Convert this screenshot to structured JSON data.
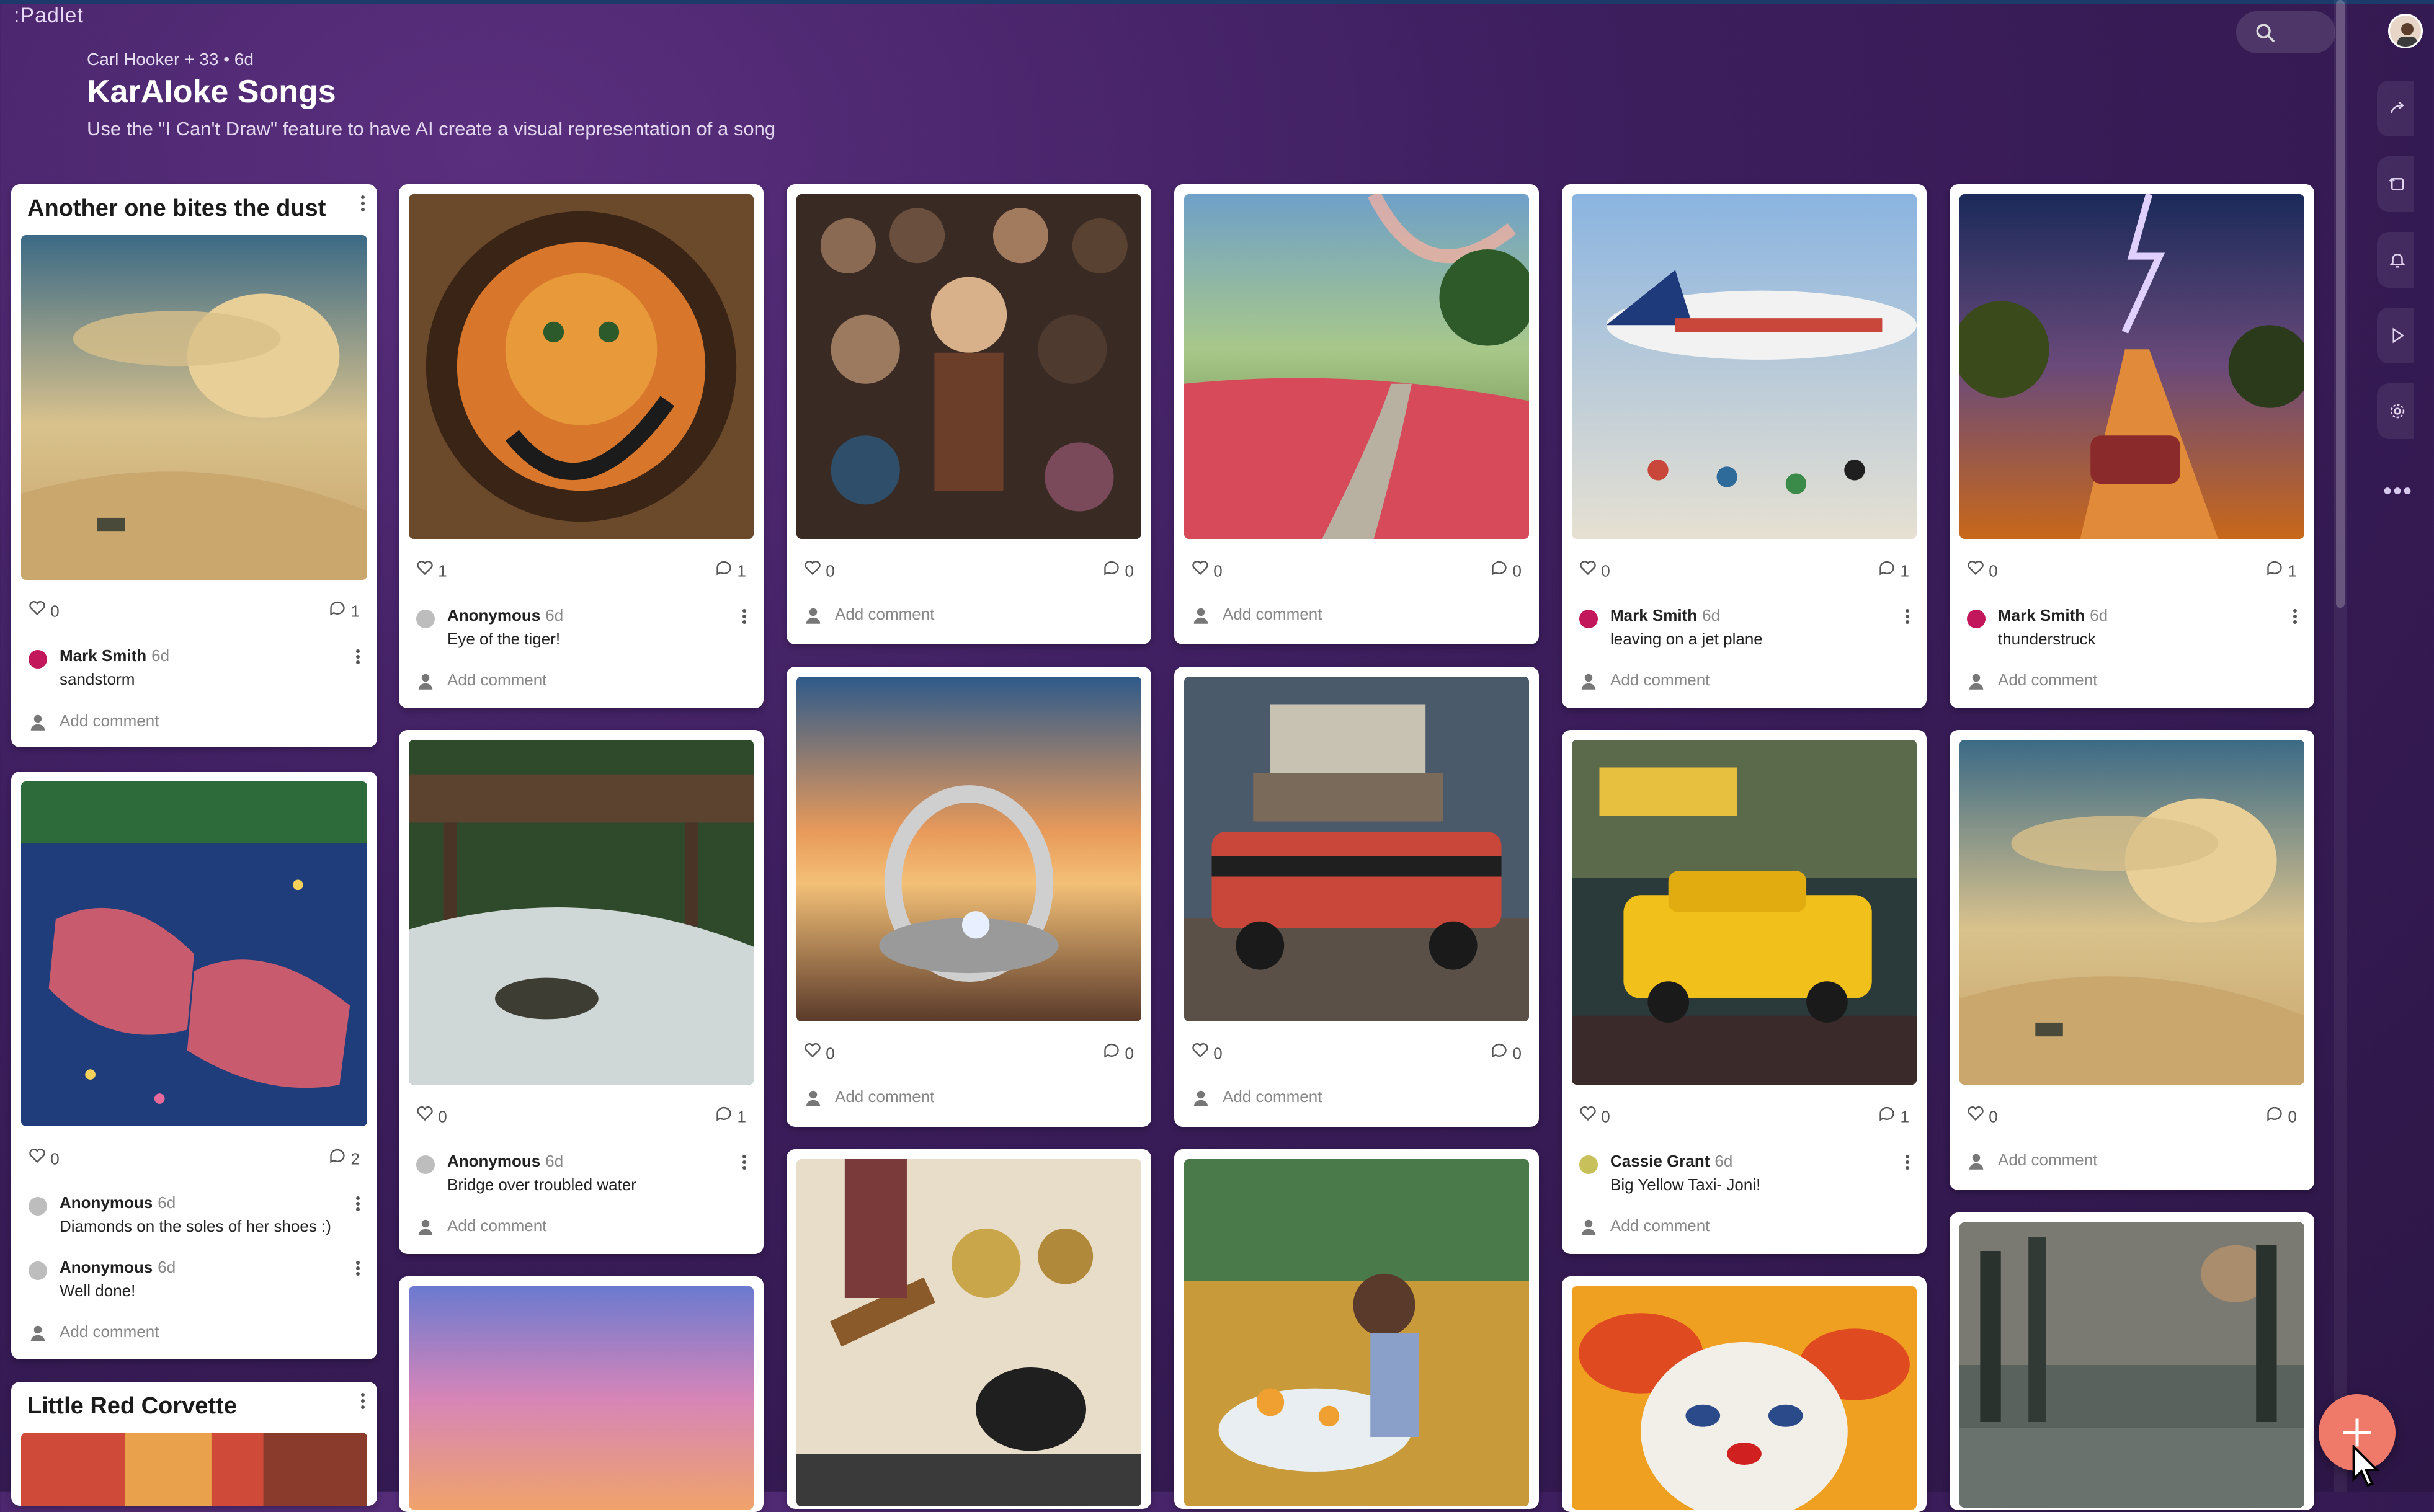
{
  "app": {
    "logo": ":Padlet"
  },
  "header": {
    "meta": "Carl Hooker + 33 • 6d",
    "title": "KarAIoke Songs",
    "description": "Use the \"I Can't Draw\" feature to have AI create a visual representation of a song"
  },
  "toolbar": {
    "search_icon": "search-icon",
    "share_icon": "share-icon",
    "remake_icon": "remake-icon",
    "bell_icon": "bell-icon",
    "play_icon": "play-icon",
    "settings_icon": "gear-icon",
    "more_icon": "more-icon"
  },
  "fab": {
    "icon": "plus-icon"
  },
  "add_comment_label": "Add comment",
  "cards": {
    "c1": {
      "title": "Another one bites the dust",
      "likes": "0",
      "comments": "1",
      "comment1": {
        "author": "Mark Smith",
        "time": "6d",
        "text": "sandstorm"
      }
    },
    "c2": {
      "likes": "1",
      "comments": "1",
      "comment1": {
        "author": "Anonymous",
        "time": "6d",
        "text": "Eye of the tiger!"
      }
    },
    "c3": {
      "likes": "0",
      "comments": "0"
    },
    "c4": {
      "likes": "0",
      "comments": "0"
    },
    "c5": {
      "likes": "0",
      "comments": "1",
      "comment1": {
        "author": "Mark Smith",
        "time": "6d",
        "text": "leaving on a jet plane"
      }
    },
    "c6": {
      "likes": "0",
      "comments": "1",
      "comment1": {
        "author": "Mark Smith",
        "time": "6d",
        "text": "thunderstruck"
      }
    },
    "c7": {
      "likes": "0",
      "comments": "2",
      "comment1": {
        "author": "Anonymous",
        "time": "6d",
        "text": "Diamonds on the soles of her shoes :)"
      },
      "comment2": {
        "author": "Anonymous",
        "time": "6d",
        "text": "Well done!"
      }
    },
    "c8": {
      "likes": "0",
      "comments": "1",
      "comment1": {
        "author": "Anonymous",
        "time": "6d",
        "text": "Bridge over troubled water"
      }
    },
    "c9": {
      "likes": "0",
      "comments": "0"
    },
    "c10": {
      "likes": "0",
      "comments": "0"
    },
    "c11": {
      "likes": "0",
      "comments": "1",
      "comment1": {
        "author": "Cassie Grant",
        "time": "6d",
        "text": "Big Yellow Taxi- Joni!"
      }
    },
    "c12": {
      "likes": "0",
      "comments": "0"
    },
    "c13": {
      "title": "Little Red Corvette"
    }
  }
}
